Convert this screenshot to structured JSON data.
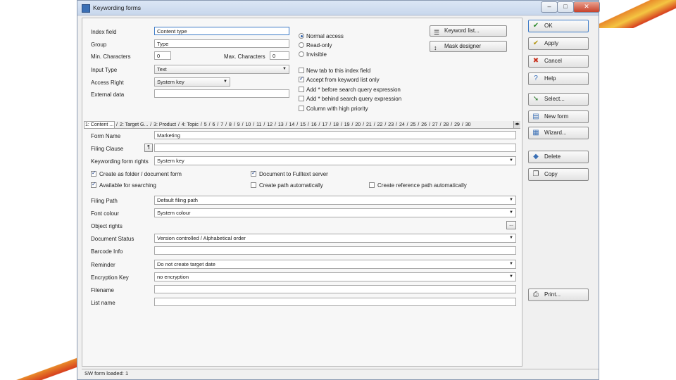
{
  "window": {
    "title": "Keywording forms",
    "controls": {
      "minimize": "–",
      "maximize": "□",
      "close": "✕"
    }
  },
  "header_fields": {
    "index_field": {
      "label": "Index field",
      "value": "Content type"
    },
    "group": {
      "label": "Group",
      "value": "Type"
    },
    "min_chars": {
      "label": "Min. Characters",
      "value": "0"
    },
    "max_chars": {
      "label": "Max. Characters",
      "value": "0"
    },
    "input_type": {
      "label": "Input Type",
      "value": "Text"
    },
    "access_right": {
      "label": "Access Right",
      "value": "System key"
    },
    "external_data": {
      "label": "External data",
      "value": ""
    }
  },
  "access_options": [
    {
      "label": "Normal access",
      "selected": true
    },
    {
      "label": "Read-only",
      "selected": false
    },
    {
      "label": "Invisible",
      "selected": false
    }
  ],
  "index_options": [
    {
      "label": "New tab to this index field",
      "checked": false
    },
    {
      "label": "Accept from keyword list only",
      "checked": true
    },
    {
      "label": "Add * before search query expression",
      "checked": false
    },
    {
      "label": "Add * behind search query expression",
      "checked": false
    },
    {
      "label": "Column with high priority",
      "checked": false
    }
  ],
  "top_buttons": {
    "keyword_list": "Keyword list...",
    "mask_designer": "Mask designer"
  },
  "tabs": {
    "items": [
      "1: Content ...",
      "2: Target G...",
      "3: Product",
      "4: Topic",
      "5",
      "6",
      "7",
      "8",
      "9",
      "10",
      "11",
      "12",
      "13",
      "14",
      "15",
      "16",
      "17",
      "18",
      "19",
      "20",
      "21",
      "22",
      "23",
      "24",
      "25",
      "26",
      "27",
      "28",
      "29",
      "30"
    ],
    "nav": "◂▸"
  },
  "form": {
    "form_name": {
      "label": "Form Name",
      "value": "Marketing"
    },
    "filing_clause": {
      "label": "Filing Clause",
      "button": "¶",
      "value": ""
    },
    "keywording_rights": {
      "label": "Keywording form rights",
      "value": "System key"
    },
    "checks": [
      {
        "label": "Create as folder / document form",
        "checked": true
      },
      {
        "label": "Document to Fulltext server",
        "checked": true
      },
      {
        "label": "Available for searching",
        "checked": true
      },
      {
        "label": "Create path automatically",
        "checked": false
      },
      {
        "label": "Create reference path automatically",
        "checked": false
      }
    ],
    "filing_path": {
      "label": "Filing Path",
      "value": "Default filing path"
    },
    "font_colour": {
      "label": "Font colour",
      "value": "System colour"
    },
    "object_rights": {
      "label": "Object rights",
      "button": "...",
      "value": ""
    },
    "document_status": {
      "label": "Document Status",
      "value": "Version controlled / Alphabetical order"
    },
    "barcode_info": {
      "label": "Barcode Info",
      "value": ""
    },
    "reminder": {
      "label": "Reminder",
      "value": "Do not create target date"
    },
    "encryption_key": {
      "label": "Encryption Key",
      "value": "no encryption"
    },
    "file_name": {
      "label": "Filename",
      "value": ""
    },
    "list_name": {
      "label": "List name",
      "value": ""
    }
  },
  "side_buttons": [
    {
      "id": "ok",
      "label": "OK",
      "icon": "check-icon",
      "glyph": "✔",
      "color": "#2e8b2e"
    },
    {
      "id": "apply",
      "label": "Apply",
      "icon": "apply-check-icon",
      "glyph": "✔",
      "color": "#b59a1c"
    },
    {
      "id": "cancel",
      "label": "Cancel",
      "icon": "cancel-icon",
      "glyph": "✖",
      "color": "#c8321e"
    },
    {
      "id": "help",
      "label": "Help",
      "icon": "help-icon",
      "glyph": "?",
      "color": "#2a66b8"
    },
    {
      "id": "select",
      "label": "Select...",
      "icon": "select-icon",
      "glyph": "➘",
      "color": "#2e7a2e"
    },
    {
      "id": "new_form",
      "label": "New form",
      "icon": "new-form-icon",
      "glyph": "▤",
      "color": "#3a6fb5"
    },
    {
      "id": "wizard",
      "label": "Wizard...",
      "icon": "wizard-icon",
      "glyph": "▦",
      "color": "#3a6fb5"
    },
    {
      "id": "delete",
      "label": "Delete",
      "icon": "delete-icon",
      "glyph": "◆",
      "color": "#3a6fb5"
    },
    {
      "id": "copy",
      "label": "Copy",
      "icon": "copy-icon",
      "glyph": "❐",
      "color": "#444444"
    },
    {
      "id": "print",
      "label": "Print...",
      "icon": "printer-icon",
      "glyph": "⎙",
      "color": "#444444"
    }
  ],
  "status": {
    "text": "SW form loaded: 1"
  }
}
